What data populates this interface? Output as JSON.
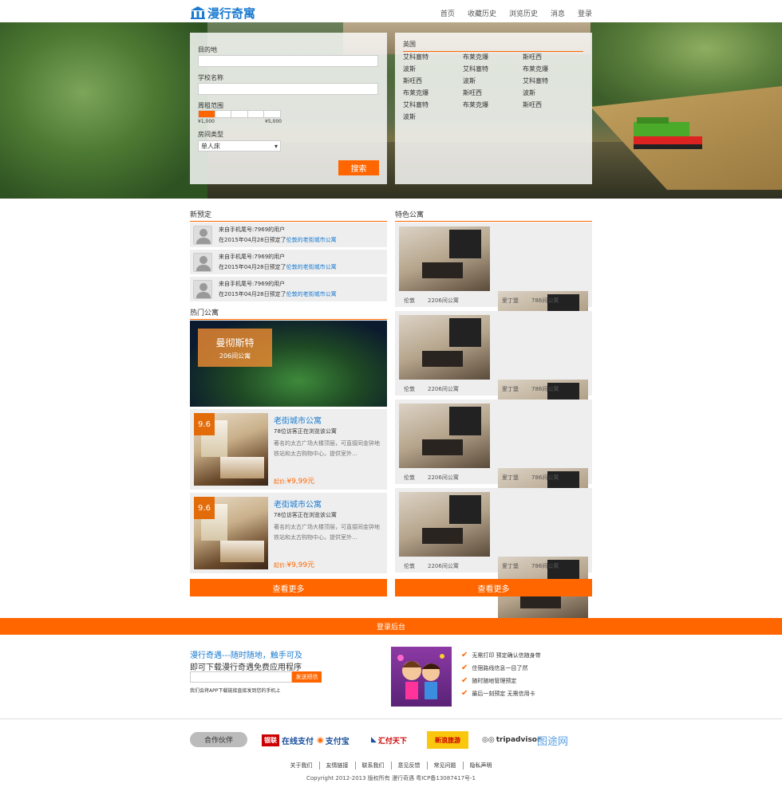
{
  "header": {
    "logo_text": "漫行奇寓",
    "nav": [
      "首页",
      "收藏历史",
      "浏览历史",
      "消息",
      "登录"
    ]
  },
  "search": {
    "destination_label": "目的地",
    "school_label": "学校名称",
    "rent_label": "周租范围",
    "rent_min": "¥1,000",
    "rent_max": "¥5,000",
    "room_label": "房间类型",
    "room_value": "单人床",
    "button": "搜索"
  },
  "cities": {
    "country": "英国",
    "list": [
      "艾科塞特",
      "布莱克爆",
      "斯旺西",
      "波斯",
      "艾科塞特",
      "布莱克爆",
      "斯旺西",
      "波斯",
      "艾科塞特",
      "布莱克爆",
      "斯旺西",
      "波斯",
      "艾科塞特",
      "布莱克爆",
      "斯旺西",
      "波斯"
    ]
  },
  "new_booking": {
    "title": "新预定",
    "items": [
      {
        "line1": "来自手机尾号:7969的用户",
        "prefix": "在2015年04月28日预定了",
        "link": "伦敦的老街城市公寓"
      },
      {
        "line1": "来自手机尾号:7969的用户",
        "prefix": "在2015年04月28日预定了",
        "link": "伦敦的老街城市公寓"
      },
      {
        "line1": "来自手机尾号:7969的用户",
        "prefix": "在2015年04月28日预定了",
        "link": "伦敦的老街城市公寓"
      }
    ]
  },
  "hot": {
    "title": "热门公寓",
    "banner_name": "曼彻斯特",
    "banner_count": "206间公寓",
    "items": [
      {
        "score": "9.6",
        "name": "老街城市公寓",
        "visitors": "78位访客正在浏览该公寓",
        "desc1": "著名的太古广场大楼顶层，可直接同金钟地",
        "desc2": "铁站和太古购物中心，提供室外...",
        "price_label": "起价:",
        "price": "¥9,99元"
      },
      {
        "score": "9.6",
        "name": "老街城市公寓",
        "visitors": "78位访客正在浏览该公寓",
        "desc1": "著名的太古广场大楼顶层，可直接同金钟地",
        "desc2": "铁站和太古购物中心，提供室外...",
        "price_label": "起价:",
        "price": "¥9,99元"
      }
    ],
    "more": "查看更多"
  },
  "featured": {
    "title": "特色公寓",
    "rows": [
      [
        {
          "city": "伦敦",
          "count": "2206间公寓"
        },
        {
          "city": "爱丁堡",
          "count": "786间公寓"
        }
      ],
      [
        {
          "city": "伦敦",
          "count": "2206间公寓"
        },
        {
          "city": "爱丁堡",
          "count": "786间公寓"
        }
      ],
      [
        {
          "city": "伦敦",
          "count": "2206间公寓"
        },
        {
          "city": "爱丁堡",
          "count": "786间公寓"
        }
      ],
      [
        {
          "city": "伦敦",
          "count": "2206间公寓"
        },
        {
          "city": "爱丁堡",
          "count": "786间公寓"
        }
      ]
    ],
    "more": "查看更多"
  },
  "admin_bar": "登录后台",
  "app": {
    "line1": "漫行奇遇---随时随地，触手可及",
    "line2": "即可下载漫行奇遇免费应用程序",
    "send_button": "发送短信",
    "note": "我们会将APP下载链接直接发到您的手机上",
    "features": [
      "无需打印 预定确认信随身带",
      "住宿路线信息一目了然",
      "随时随地管理预定",
      "最后一刻预定 无需信用卡"
    ]
  },
  "partners": {
    "label": "合作伙伴",
    "logos": [
      "在线支付",
      "支付宝",
      "汇付天下",
      "新浪旅游",
      "tripadvisor",
      "图途网"
    ]
  },
  "footer": {
    "links": [
      "关于我们",
      "友情链接",
      "联系我们",
      "意见反馈",
      "常见问题",
      "隐私声明"
    ],
    "copyright": "Copyright 2012-2013 版权所有 漫行奇遇 粤ICP备13087417号-1"
  },
  "colors": {
    "accent": "#ff6600",
    "link": "#1a7bd0"
  }
}
